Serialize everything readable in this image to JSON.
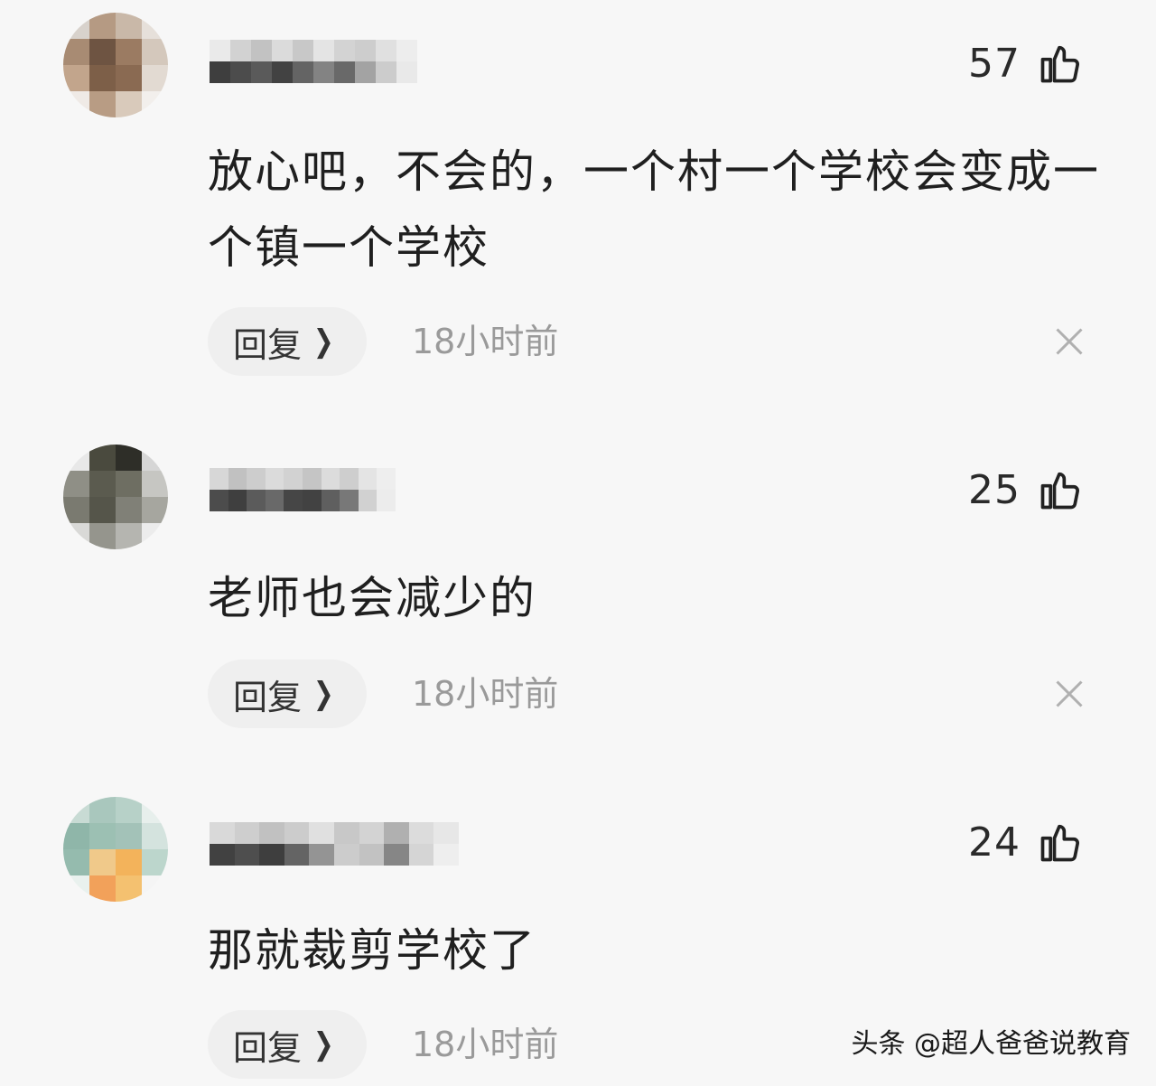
{
  "comments": [
    {
      "likes": "57",
      "text": "放心吧，不会的，一个村一个学校会变成一个镇一个学校",
      "reply_label": "回复",
      "time": "18小时前",
      "avatar_colors": [
        "#d8d2cc",
        "#b59a83",
        "#c9b8a8",
        "#e6e0da",
        "#a88b73",
        "#6e5442",
        "#9b7b62",
        "#d4c8bc",
        "#c2a58c",
        "#7d5f48",
        "#8a6a52",
        "#e2dad2",
        "#efeae6",
        "#b89c84",
        "#d9cabb",
        "#f2efec"
      ],
      "name_colors": [
        "#e9e9e9",
        "#cfcfcf",
        "#bdbdbd",
        "#d9d9d9",
        "#c4c4c4",
        "#e2e2e2",
        "#d0d0d0",
        "#c9c9c9",
        "#dedede",
        "#ededed",
        "#2b2b2b",
        "#3a3a3a",
        "#4a4a4a",
        "#2f2f2f",
        "#555555",
        "#777777",
        "#5a5a5a",
        "#9a9a9a",
        "#c8c8c8",
        "#e8e8e8"
      ]
    },
    {
      "likes": "25",
      "text": "老师也会减少的",
      "reply_label": "回复",
      "time": "18小时前",
      "avatar_colors": [
        "#e8e8e8",
        "#4a4a3e",
        "#2e2e28",
        "#d6d6d6",
        "#8f8f86",
        "#5b5b4f",
        "#6e6e62",
        "#c6c6c2",
        "#7a7a70",
        "#55554a",
        "#808077",
        "#a6a69f",
        "#d9d9d7",
        "#95958d",
        "#b5b5b0",
        "#ececec"
      ],
      "name_colors": [
        "#d4d4d4",
        "#bcbcbc",
        "#c9c9c9",
        "#d8d8d8",
        "#cfcfcf",
        "#c0c0c0",
        "#dadada",
        "#cacaca",
        "#e3e3e3",
        "#eeeeee",
        "#3a3a3a",
        "#2c2c2c",
        "#4b4b4b",
        "#5a5a5a",
        "#333333",
        "#2f2f2f",
        "#4f4f4f",
        "#6b6b6b",
        "#cdcdcd",
        "#ebebeb"
      ]
    },
    {
      "likes": "24",
      "text": "那就裁剪学校了",
      "reply_label": "回复",
      "time": "18小时前",
      "avatar_colors": [
        "#c8dbd4",
        "#a9c7bd",
        "#b7d1c8",
        "#e7efec",
        "#8fb6a9",
        "#9cc0b3",
        "#a3c2b8",
        "#d4e3de",
        "#95bbae",
        "#f0c98a",
        "#f3b35b",
        "#bcd6cc",
        "#e9f1ee",
        "#f2a15a",
        "#f4c170",
        "#f5f5f5"
      ],
      "name_colors": [
        "#d6d6d6",
        "#cacaca",
        "#bcbcbc",
        "#c8c8c8",
        "#dedede",
        "#c3c3c3",
        "#d0d0d0",
        "#a9a9a9",
        "#dadada",
        "#e6e6e6",
        "#2e2e2e",
        "#3c3c3c",
        "#2a2a2a",
        "#555555",
        "#8a8a8a",
        "#c8c8c8",
        "#bdbdbd",
        "#7a7a7a",
        "#d2d2d2",
        "#eeeeee"
      ]
    }
  ],
  "watermark": "头条 @超人爸爸说教育"
}
